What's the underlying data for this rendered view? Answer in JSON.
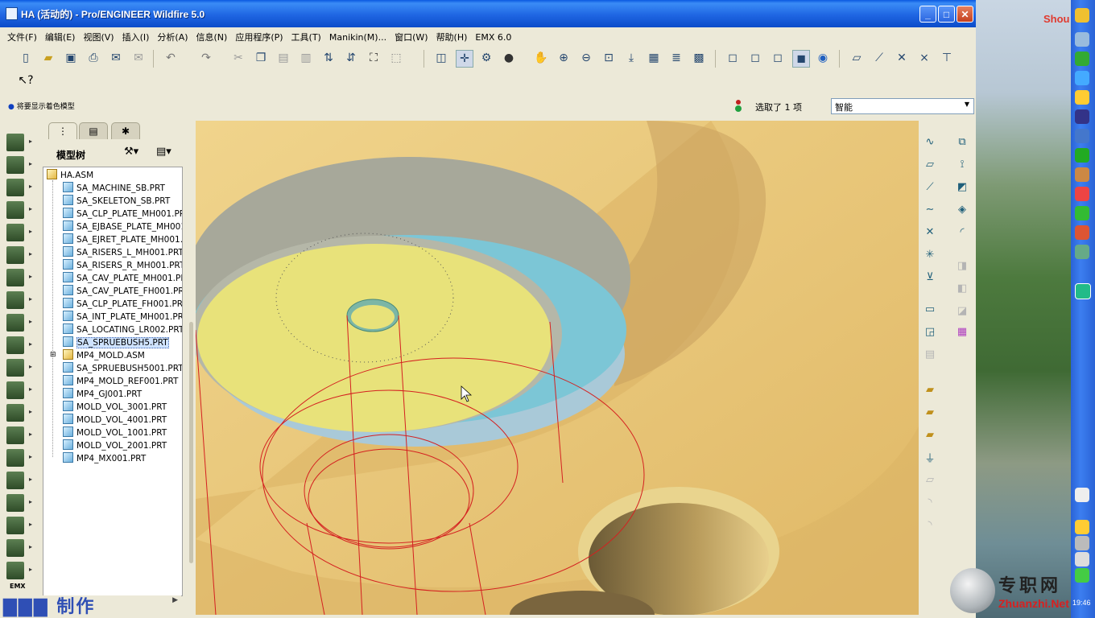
{
  "window": {
    "title": "HA (活动的) - Pro/ENGINEER Wildfire 5.0",
    "minimize": "_",
    "maximize": "□",
    "close": "✕"
  },
  "menu": [
    "文件(F)",
    "编辑(E)",
    "视图(V)",
    "插入(I)",
    "分析(A)",
    "信息(N)",
    "应用程序(P)",
    "工具(T)",
    "Manikin(M)...",
    "窗口(W)",
    "帮助(H)",
    "EMX 6.0"
  ],
  "message": "将要显示着色模型",
  "selection": {
    "info": "选取了 1 项",
    "filter": "智能"
  },
  "model_tree": {
    "title": "模型树",
    "root": "HA.ASM",
    "items": [
      {
        "name": "SA_MACHINE_SB.PRT",
        "type": "part"
      },
      {
        "name": "SA_SKELETON_SB.PRT",
        "type": "part"
      },
      {
        "name": "SA_CLP_PLATE_MH001.PR",
        "type": "part"
      },
      {
        "name": "SA_EJBASE_PLATE_MH001",
        "type": "part"
      },
      {
        "name": "SA_EJRET_PLATE_MH001.",
        "type": "part"
      },
      {
        "name": "SA_RISERS_L_MH001.PRT",
        "type": "part"
      },
      {
        "name": "SA_RISERS_R_MH001.PRT",
        "type": "part"
      },
      {
        "name": "SA_CAV_PLATE_MH001.PF",
        "type": "part"
      },
      {
        "name": "SA_CAV_PLATE_FH001.PR",
        "type": "part"
      },
      {
        "name": "SA_CLP_PLATE_FH001.PR",
        "type": "part"
      },
      {
        "name": "SA_INT_PLATE_MH001.PR",
        "type": "part"
      },
      {
        "name": "SA_LOCATING_LR002.PRT",
        "type": "part"
      },
      {
        "name": "SA_SPRUEBUSH5.PRT",
        "type": "part",
        "selected": true
      },
      {
        "name": "MP4_MOLD.ASM",
        "type": "assembly",
        "expandable": true
      },
      {
        "name": "SA_SPRUEBUSH5001.PRT",
        "type": "part"
      },
      {
        "name": "MP4_MOLD_REF001.PRT",
        "type": "part"
      },
      {
        "name": "MP4_GJ001.PRT",
        "type": "part"
      },
      {
        "name": "MOLD_VOL_3001.PRT",
        "type": "part"
      },
      {
        "name": "MOLD_VOL_4001.PRT",
        "type": "part"
      },
      {
        "name": "MOLD_VOL_1001.PRT",
        "type": "part"
      },
      {
        "name": "MOLD_VOL_2001.PRT",
        "type": "part"
      },
      {
        "name": "MP4_MX001.PRT",
        "type": "part"
      }
    ]
  },
  "left_toolbar_label": "EMX",
  "watermark": "制作",
  "desktop": {
    "label": "Shou",
    "logo_cn": "专职网",
    "logo_en": "Zhuanzhi.Net",
    "clock": "19:46"
  },
  "colors": {
    "title_blue": "#1f66e3",
    "viewport_bg": "#e7c57a",
    "part_yellow": "#e8e27a",
    "cyan_ring": "#7cc6d6",
    "wire_red": "#d42020"
  }
}
